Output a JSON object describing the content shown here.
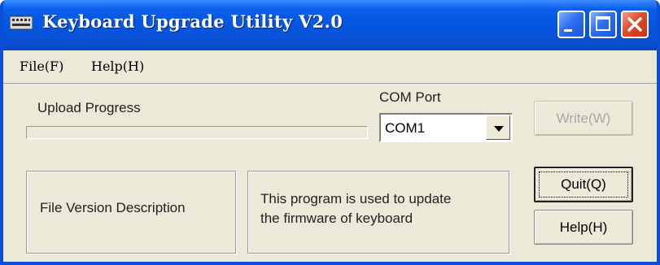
{
  "window": {
    "title": "Keyboard Upgrade Utility V2.0"
  },
  "menu": {
    "file": "File(F)",
    "help": "Help(H)"
  },
  "upload": {
    "label": "Upload Progress",
    "progress": 0
  },
  "com_port": {
    "label": "COM Port",
    "selected": "COM1"
  },
  "buttons": {
    "write": "Write(W)",
    "quit": "Quit(Q)",
    "help": "Help(H)"
  },
  "panels": {
    "file_version": "File Version Description",
    "description_line1": "This program is used to update",
    "description_line2": "the firmware of keyboard"
  },
  "colors": {
    "titlebar": "#0555e0",
    "face": "#ece9d8",
    "close": "#e3492a"
  }
}
